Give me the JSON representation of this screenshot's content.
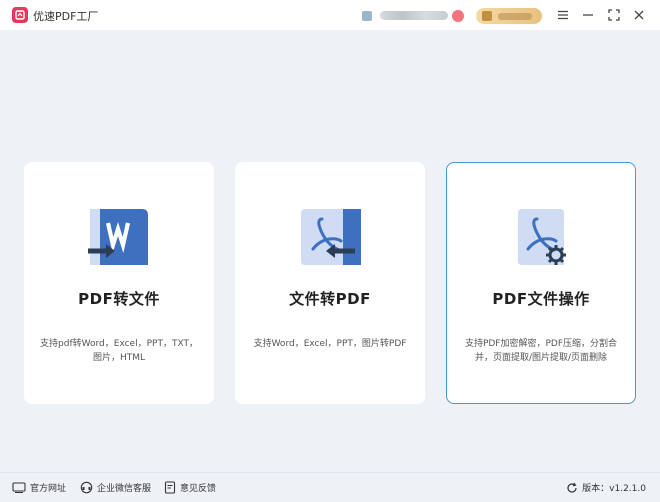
{
  "app": {
    "title": "优速PDF工厂"
  },
  "cards": [
    {
      "title": "PDF转文件",
      "desc_line1": "支持pdf转Word，Excel，PPT，TXT，",
      "desc_line2": "图片，HTML",
      "icon": "pdf-to-word-icon"
    },
    {
      "title": "文件转PDF",
      "desc_line1": "支持Word，Excel，PPT，图片转PDF",
      "desc_line2": "",
      "icon": "file-to-pdf-icon"
    },
    {
      "title": "PDF文件操作",
      "desc_line1": "支持PDF加密解密，PDF压缩，分割合",
      "desc_line2": "并，页面提取/图片提取/页面删除",
      "icon": "pdf-operations-icon"
    }
  ],
  "footer": {
    "website": "官方网址",
    "wechat_support": "企业微信客服",
    "feedback": "意见反馈",
    "version_label": "版本：v1.2.1.0"
  },
  "colors": {
    "accent": "#4a97d2",
    "logo": "#e8365d",
    "doc_blue": "#3f6fbf",
    "doc_light": "#cfdcf3"
  }
}
